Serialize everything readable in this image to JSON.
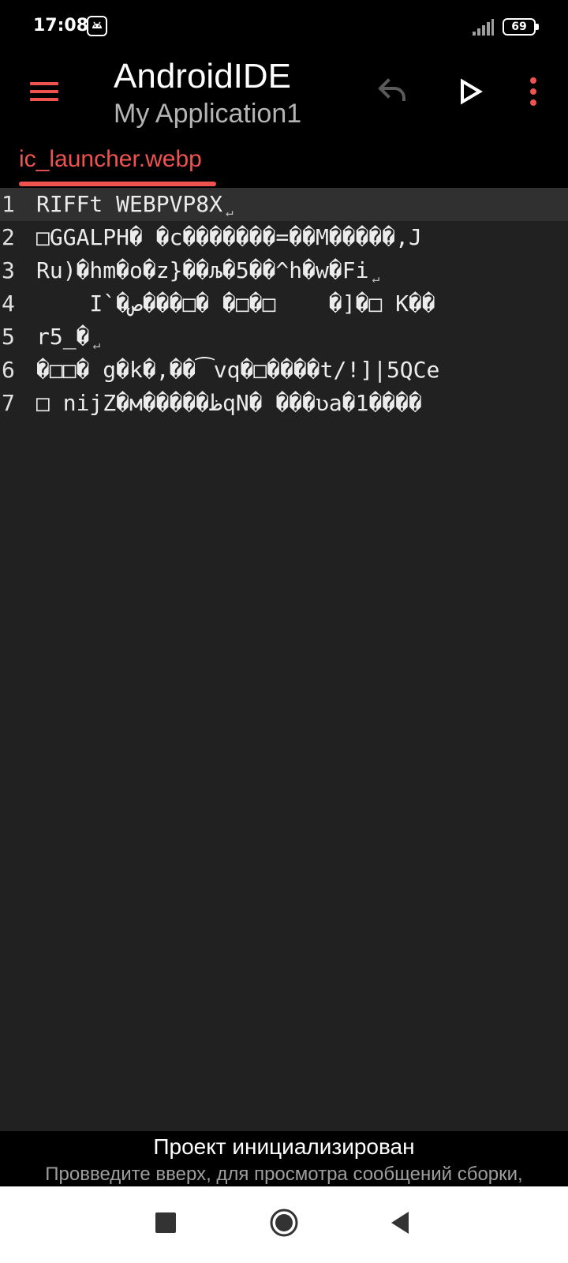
{
  "status_bar": {
    "time": "17:08",
    "app_icon": "android-bug-icon",
    "signal_icon": "cell-signal-icon",
    "battery_level": "69"
  },
  "toolbar": {
    "title": "AndroidIDE",
    "project": "My Application1",
    "icons": [
      "menu-icon",
      "undo-icon",
      "run-icon",
      "more-vert-icon"
    ]
  },
  "tabs": [
    {
      "label": "ic_launcher.webp",
      "active": true
    }
  ],
  "editor": {
    "lines": [
      {
        "num": "1",
        "text": "RIFFt WEBPVP8X"
      },
      {
        "num": "2",
        "text": "□GGALPH� �c�������=��M�����,J"
      },
      {
        "num": "3",
        "text": "Ru)�hm�o�z}��љ�5��^h�w�Fi"
      },
      {
        "num": "4",
        "text": "    I`�ص���□� �□�□    �]�□ K��"
      },
      {
        "num": "5",
        "text": "r5_�"
      },
      {
        "num": "6",
        "text": "�□□� g�k�,��⁀vq�□����t/!]|5QCe"
      },
      {
        "num": "7",
        "text": "□ nijZ�м�����ظqN� ���ʋa�1����"
      }
    ],
    "newline_lines": [
      1,
      3,
      5
    ],
    "newline_mark": "↵"
  },
  "build": {
    "title": "Проект инициализирован",
    "hint": "Провведите вверх, для просмотра сообщений сборки,"
  },
  "colors": {
    "accent": "#ef5350",
    "editor_bg": "#212121",
    "current_line": "#303030"
  }
}
